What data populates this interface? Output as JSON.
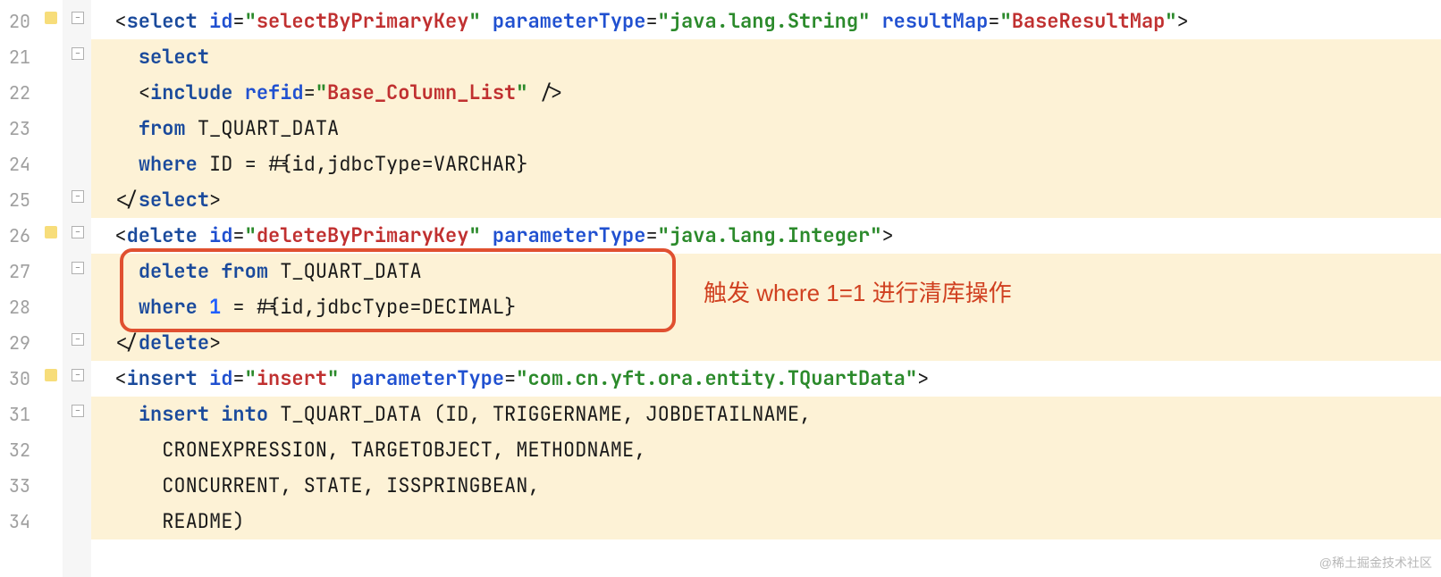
{
  "line_numbers": [
    "20",
    "21",
    "22",
    "23",
    "24",
    "25",
    "26",
    "27",
    "28",
    "29",
    "30",
    "31",
    "32",
    "33",
    "34"
  ],
  "callout_text": "触发 where 1=1 进行清库操作",
  "watermark": "@稀土掘金技术社区",
  "code": {
    "l20": {
      "indent": "  ",
      "open": "<",
      "tag": "select",
      "sp1": " ",
      "attr1": "id",
      "eq1": "=",
      "q1a": "\"",
      "val1": "selectByPrimaryKey",
      "q1b": "\"",
      "sp2": " ",
      "attr2": "parameterType",
      "eq2": "=",
      "q2a": "\"",
      "val2": "java.lang.String",
      "q2b": "\"",
      "sp3": " ",
      "attr3": "resultMap",
      "eq3": "=",
      "q3a": "\"",
      "val3": "BaseResultMap",
      "q3b": "\"",
      "close": ">"
    },
    "l21": {
      "indent": "    ",
      "kw": "select"
    },
    "l22": {
      "indent": "    ",
      "open": "<",
      "tag": "include",
      "sp1": " ",
      "attr1": "refid",
      "eq1": "=",
      "q1a": "\"",
      "val1": "Base_Column_List",
      "q1b": "\"",
      "sp2": " ",
      "close": "/>"
    },
    "l23": {
      "indent": "    ",
      "kw": "from",
      "sp": " ",
      "tbl": "T_QUART_DATA"
    },
    "l24": {
      "indent": "    ",
      "kw": "where",
      "rest": " ID = #{id,jdbcType=VARCHAR}"
    },
    "l25": {
      "indent": "  ",
      "open": "</",
      "tag": "select",
      "close": ">"
    },
    "l26": {
      "indent": "  ",
      "open": "<",
      "tag": "delete",
      "sp1": " ",
      "attr1": "id",
      "eq1": "=",
      "q1a": "\"",
      "val1": "deleteByPrimaryKey",
      "q1b": "\"",
      "sp2": " ",
      "attr2": "parameterType",
      "eq2": "=",
      "q2a": "\"",
      "val2": "java.lang.Integer",
      "q2b": "\"",
      "close": ">"
    },
    "l27": {
      "indent": "    ",
      "kw1": "delete",
      "sp1": " ",
      "kw2": "from",
      "sp2": " ",
      "tbl": "T_QUART_DATA"
    },
    "l28": {
      "indent": "    ",
      "kw": "where",
      "sp1": " ",
      "num": "1",
      "rest": " = #{id,jdbcType=DECIMAL}"
    },
    "l29": {
      "indent": "  ",
      "open": "</",
      "tag": "delete",
      "close": ">"
    },
    "l30": {
      "indent": "  ",
      "open": "<",
      "tag": "insert",
      "sp1": " ",
      "attr1": "id",
      "eq1": "=",
      "q1a": "\"",
      "val1": "insert",
      "q1b": "\"",
      "sp2": " ",
      "attr2": "parameterType",
      "eq2": "=",
      "q2a": "\"",
      "val2": "com.cn.yft.ora.entity.TQuartData",
      "q2b": "\"",
      "close": ">"
    },
    "l31": {
      "indent": "    ",
      "kw1": "insert",
      "sp1": " ",
      "kw2": "into",
      "rest": " T_QUART_DATA (ID, TRIGGERNAME, JOBDETAILNAME,"
    },
    "l32": {
      "indent": "      ",
      "txt": "CRONEXPRESSION, TARGETOBJECT, METHODNAME,"
    },
    "l33": {
      "indent": "      ",
      "txt": "CONCURRENT, STATE, ISSPRINGBEAN,"
    },
    "l34": {
      "indent": "      ",
      "txt": "README)"
    }
  }
}
